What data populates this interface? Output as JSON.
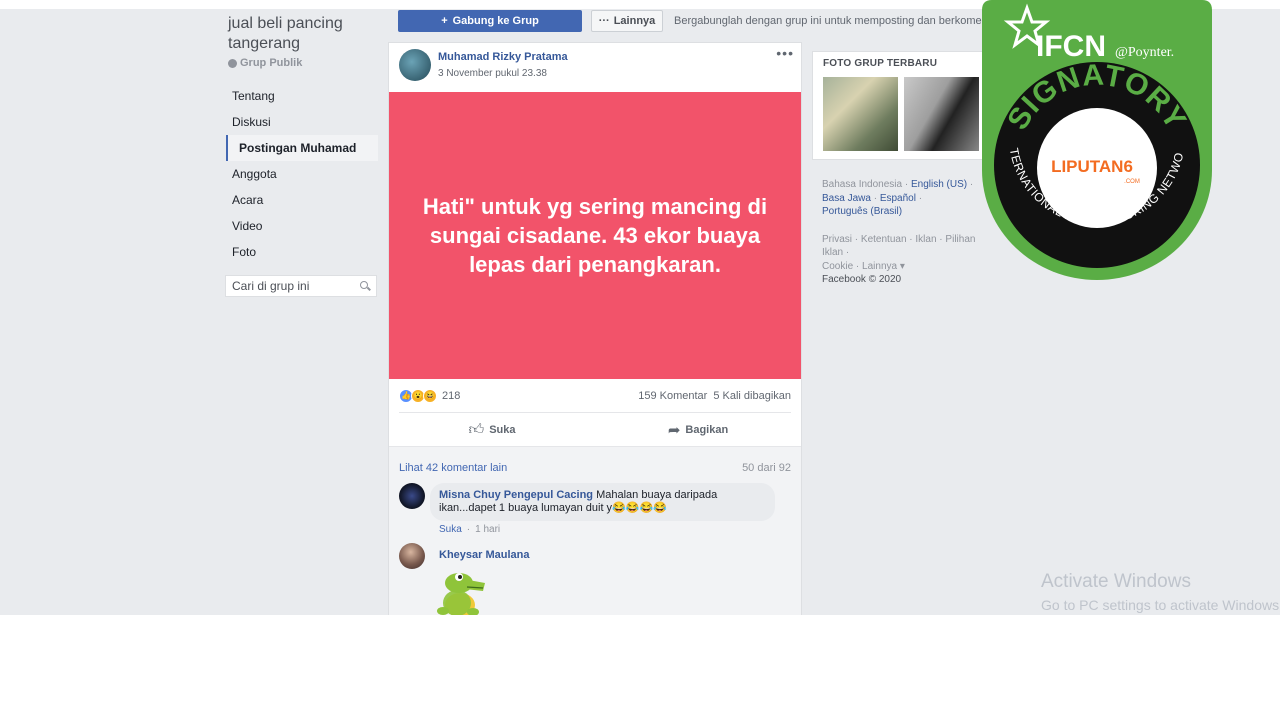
{
  "group": {
    "title": "jual beli pancing tangerang",
    "type": "Grup Publik",
    "nav": [
      "Tentang",
      "Diskusi",
      "Postingan Muhamad",
      "Anggota",
      "Acara",
      "Video",
      "Foto"
    ],
    "search_placeholder": "Cari di grup ini"
  },
  "actions": {
    "join_label": "Gabung ke Grup",
    "more_label": "Lainnya",
    "join_note": "Bergabunglah dengan grup ini untuk memposting dan berkomentar."
  },
  "post": {
    "author": "Muhamad Rizky Pratama",
    "time": "3 November pukul 23.38",
    "text": "Hati\" untuk yg sering mancing di sungai cisadane. 43 ekor buaya lepas dari penangkaran.",
    "card_color": "#f2536a",
    "reaction_count": "218",
    "comments_count": "159 Komentar",
    "shares_count": "5 Kali dibagikan",
    "like_label": "Suka",
    "share_label": "Bagikan"
  },
  "comments": {
    "more_label": "Lihat 42 komentar lain",
    "count_label": "50 dari 92",
    "items": [
      {
        "name": "Misna Chuy Pengepul Cacing",
        "text": "Mahalan buaya daripada ikan...dapet 1 buaya lumayan duit y😂😂😂😂",
        "like": "Suka",
        "time": "1 hari"
      },
      {
        "name": "Kheysar Maulana"
      }
    ]
  },
  "right": {
    "photos_title": "FOTO GRUP TERBARU",
    "lang_current": "Bahasa Indonesia",
    "langs": [
      "English (US)",
      "Basa Jawa",
      "Español",
      "Português (Brasil)"
    ],
    "footer_links": [
      "Privasi",
      "Ketentuan",
      "Iklan",
      "Pilihan Iklan",
      "Cookie",
      "Lainnya"
    ],
    "copyright": "Facebook © 2020"
  },
  "badge": {
    "ifcn": "IFCN",
    "poynter": "@Poynter.",
    "signatory": "SIGNATORY",
    "ring_text": "INTERNATIONAL FACT-CHECKING NETWORK",
    "logo": "LIPUTAN6",
    "logo_sub": ".COM",
    "green": "#5aad45"
  },
  "watermark": {
    "line1": "Activate Windows",
    "line2": "Go to PC settings to activate Windows."
  }
}
